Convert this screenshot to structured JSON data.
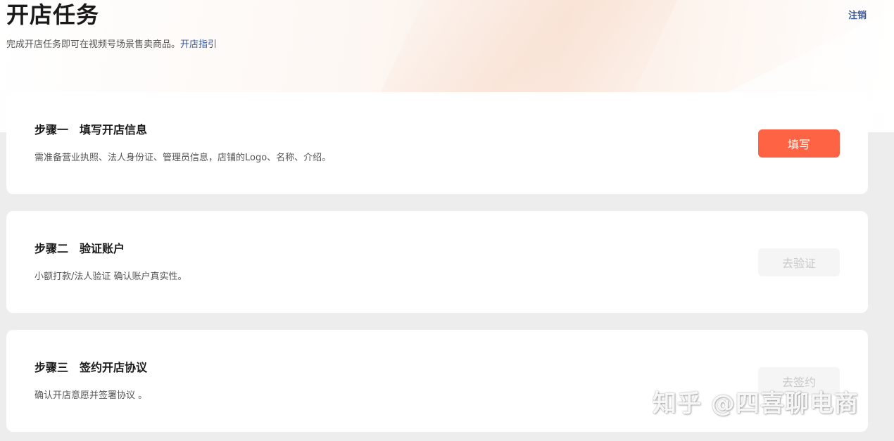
{
  "header": {
    "title": "开店任务",
    "subtitle": "完成开店任务即可在视频号场景售卖商品。",
    "guide_link": "开店指引",
    "logout": "注销"
  },
  "steps": [
    {
      "step_label": "步骤一",
      "title": "填写开店信息",
      "description": "需准备营业执照、法人身份证、管理员信息，店铺的Logo、名称、介绍。",
      "button_label": "填写",
      "button_state": "enabled"
    },
    {
      "step_label": "步骤二",
      "title": "验证账户",
      "description": "小额打款/法人验证 确认账户真实性。",
      "button_label": "去验证",
      "button_state": "disabled"
    },
    {
      "step_label": "步骤三",
      "title": "签约开店协议",
      "description": "确认开店意愿并签署协议 。",
      "button_label": "去签约",
      "button_state": "disabled"
    }
  ],
  "watermark": "知乎 @四喜聊电商",
  "colors": {
    "primary_button": "#fe6343",
    "link": "#3b5998",
    "page_background": "#ededed"
  }
}
